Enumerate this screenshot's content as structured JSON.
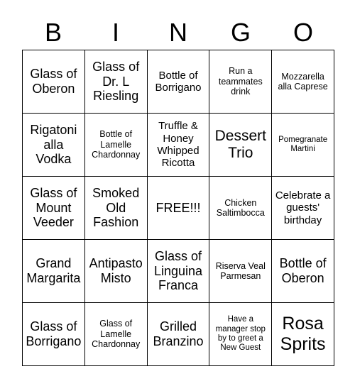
{
  "card": {
    "header_letters": [
      "B",
      "I",
      "N",
      "G",
      "O"
    ],
    "rows": [
      [
        {
          "text": "Glass of Oberon",
          "size": "md"
        },
        {
          "text": "Glass of Dr. L Riesling",
          "size": "md"
        },
        {
          "text": "Bottle of Borrigano",
          "size": "sm"
        },
        {
          "text": "Run a teammates drink",
          "size": "xs"
        },
        {
          "text": "Mozzarella alla Caprese",
          "size": "xs"
        }
      ],
      [
        {
          "text": "Rigatoni alla Vodka",
          "size": "md"
        },
        {
          "text": "Bottle of Lamelle Chardonnay",
          "size": "xs"
        },
        {
          "text": "Truffle & Honey Whipped Ricotta",
          "size": "sm"
        },
        {
          "text": "Dessert Trio",
          "size": "lg"
        },
        {
          "text": "Pomegranate Martini",
          "size": "xxs"
        }
      ],
      [
        {
          "text": "Glass of Mount Veeder",
          "size": "md"
        },
        {
          "text": "Smoked Old Fashion",
          "size": "md"
        },
        {
          "text": "FREE!!!",
          "size": "md"
        },
        {
          "text": "Chicken Saltimbocca",
          "size": "xs"
        },
        {
          "text": "Celebrate a guests' birthday",
          "size": "sm"
        }
      ],
      [
        {
          "text": "Grand Margarita",
          "size": "md"
        },
        {
          "text": "Antipasto Misto",
          "size": "md"
        },
        {
          "text": "Glass of Linguina Franca",
          "size": "md"
        },
        {
          "text": "Riserva Veal Parmesan",
          "size": "xs"
        },
        {
          "text": "Bottle of Oberon",
          "size": "md"
        }
      ],
      [
        {
          "text": "Glass of Borrigano",
          "size": "md"
        },
        {
          "text": "Glass of Lamelle Chardonnay",
          "size": "xs"
        },
        {
          "text": "Grilled Branzino",
          "size": "md"
        },
        {
          "text": "Have a manager stop by to greet a New Guest",
          "size": "xxs"
        },
        {
          "text": "Rosa Sprits",
          "size": "xl"
        }
      ]
    ]
  }
}
